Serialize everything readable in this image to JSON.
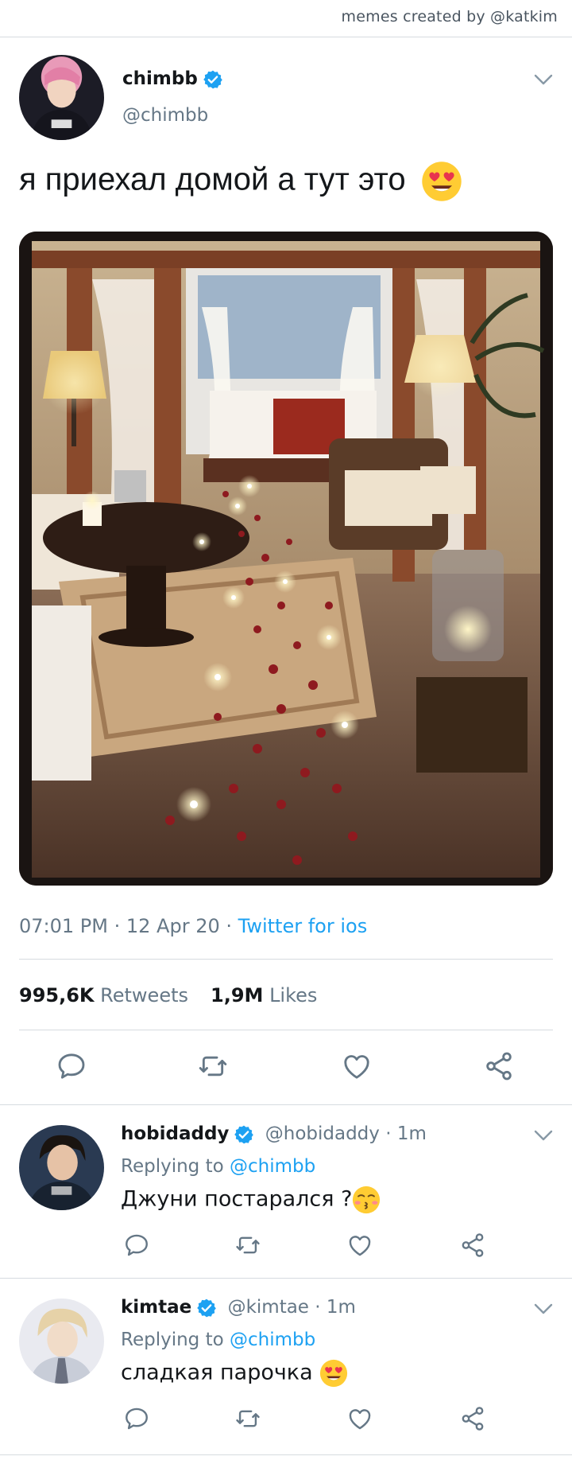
{
  "credit": "memes created by @katkim",
  "tweet": {
    "name": "chimbb",
    "handle": "@chimbb",
    "text": "я приехал домой а тут это",
    "time": "07:01 PM",
    "date": "12 Apr 20",
    "source": "Twitter for ios",
    "retweets_count": "995,6K",
    "retweets_label": "Retweets",
    "likes_count": "1,9M",
    "likes_label": "Likes"
  },
  "replies": [
    {
      "name": "hobidaddy",
      "handle": "@hobidaddy",
      "time": "1m",
      "replying_label": "Replying to",
      "replying_to": "@chimbb",
      "text": "Джуни постарался ?",
      "emoji": "kissing-face"
    },
    {
      "name": "kimtae",
      "handle": "@kimtae",
      "time": "1m",
      "replying_label": "Replying to",
      "replying_to": "@chimbb",
      "text": "сладкая парочка",
      "emoji": "heart-eyes-face"
    }
  ],
  "colors": {
    "accent": "#1da1f2",
    "muted": "#657786",
    "text": "#14171a",
    "divider": "#d6dbe0"
  }
}
